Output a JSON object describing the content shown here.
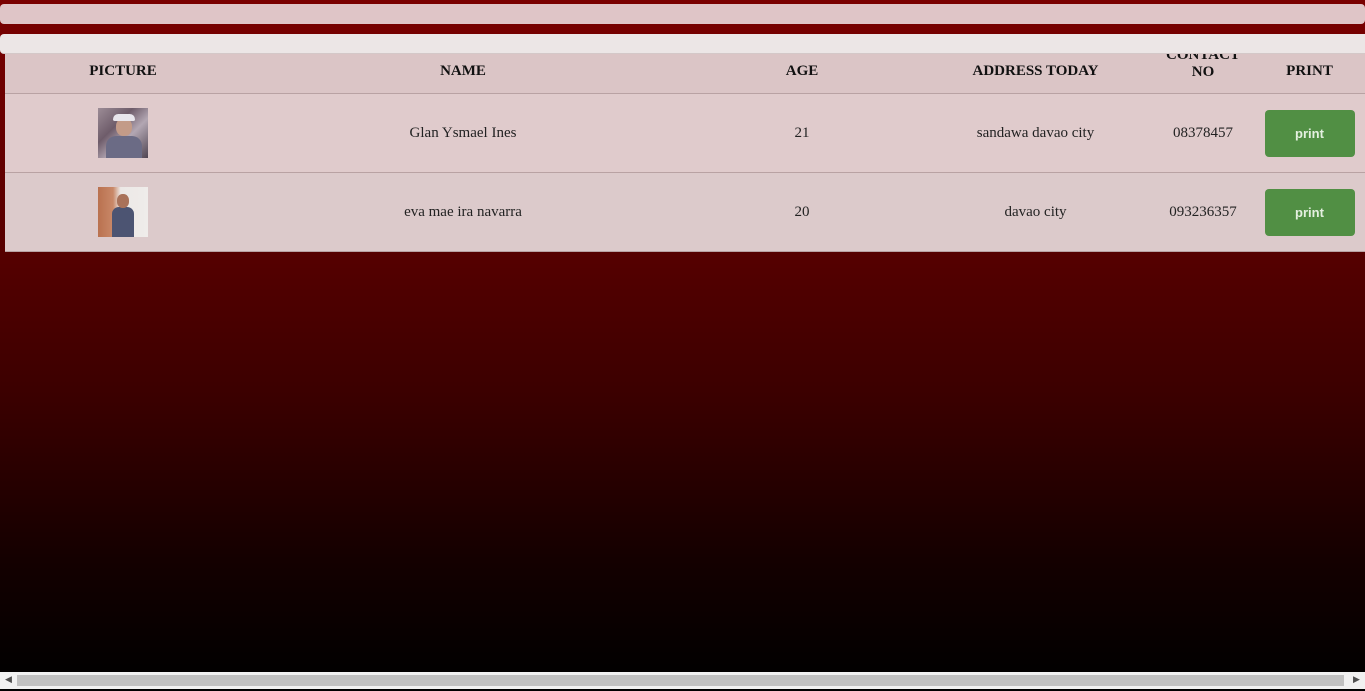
{
  "table": {
    "headers": {
      "picture": "PICTURE",
      "name": "NAME",
      "age": "AGE",
      "address": "ADDRESS TODAY",
      "contact_line1": "CONTACT",
      "contact_line2": "NO",
      "print": "PRINT"
    },
    "rows": [
      {
        "picture_icon": "person-photo-icon",
        "name": "Glan Ysmael Ines",
        "age": "21",
        "address": "sandawa davao city",
        "contact": "08378457",
        "print_label": "print"
      },
      {
        "picture_icon": "person-photo-icon",
        "name": "eva mae ira navarra",
        "age": "20",
        "address": "davao city",
        "contact": "093236357",
        "print_label": "print"
      }
    ]
  },
  "scrollbar": {
    "left_arrow": "◀",
    "right_arrow": "▶"
  },
  "colors": {
    "background_top": "#7a0000",
    "background_bottom": "#000000",
    "table_bg": "#dbc5c6",
    "print_button": "#518f44"
  }
}
